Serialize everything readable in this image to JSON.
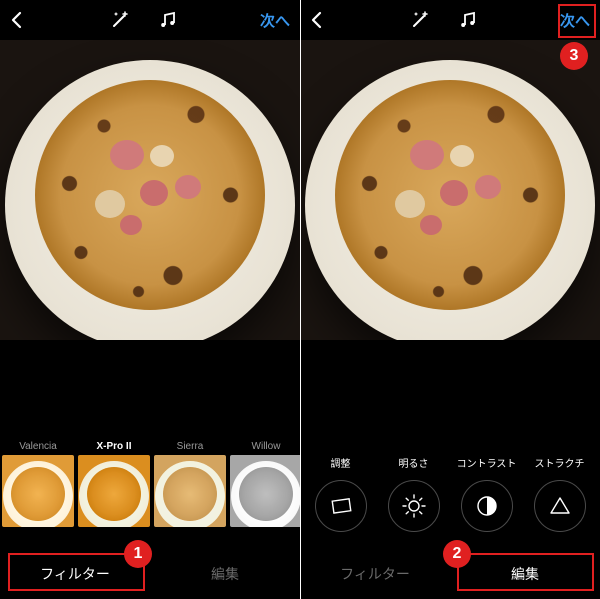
{
  "header": {
    "next_label": "次へ"
  },
  "filters": {
    "items": [
      {
        "label": "Valencia"
      },
      {
        "label": "X-Pro II"
      },
      {
        "label": "Sierra"
      },
      {
        "label": "Willow"
      }
    ],
    "selected_index": 1
  },
  "edit_tools": {
    "items": [
      {
        "label": "調整"
      },
      {
        "label": "明るさ"
      },
      {
        "label": "コントラスト"
      },
      {
        "label": "ストラクチ"
      }
    ]
  },
  "tabs": {
    "filter": "フィルター",
    "edit": "編集"
  },
  "callouts": {
    "c1": "1",
    "c2": "2",
    "c3": "3"
  }
}
